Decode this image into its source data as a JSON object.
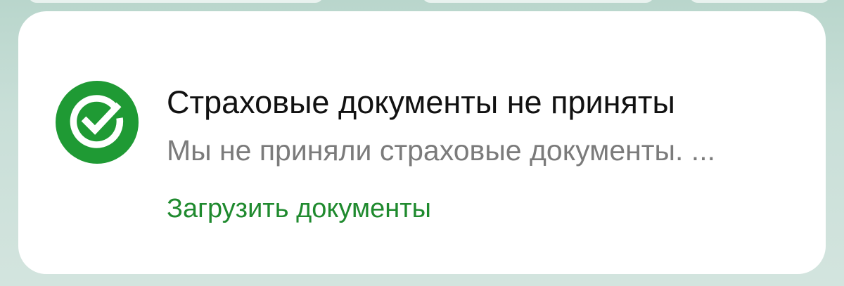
{
  "notification": {
    "icon": "sber-checkmark-icon",
    "title": "Страховые документы не приняты",
    "message": "Мы не приняли страховые документы. ...",
    "action_label": "Загрузить документы"
  },
  "colors": {
    "brand_green": "#1f9a34",
    "action_green": "#1f8a2e",
    "title_text": "#111111",
    "message_text": "#7b7b7b"
  }
}
